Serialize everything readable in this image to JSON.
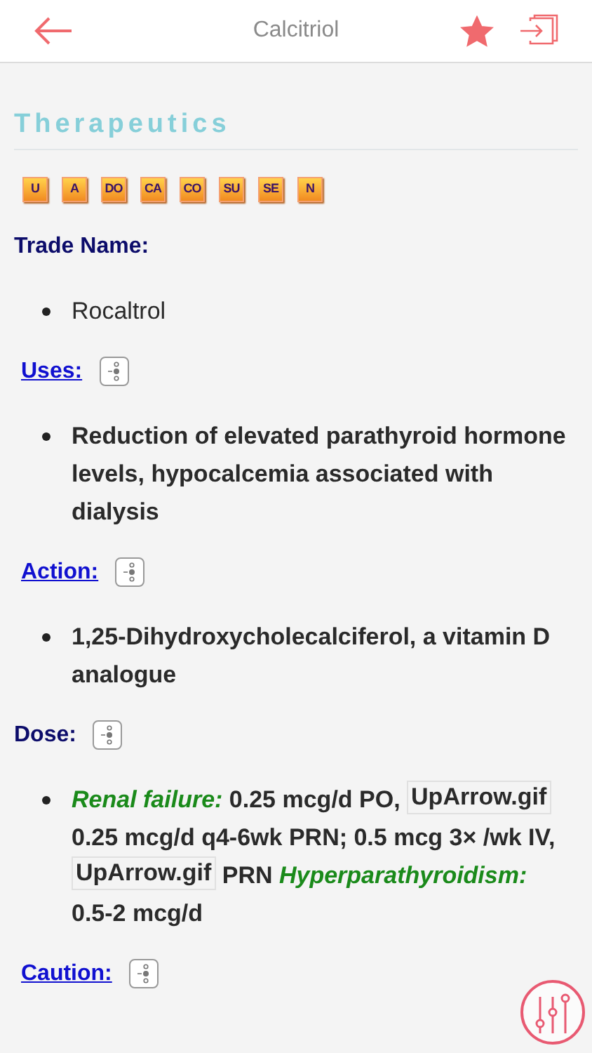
{
  "header": {
    "title": "Calcitriol",
    "favorite": true
  },
  "section_title": "Therapeutics",
  "badges": [
    "U",
    "A",
    "DO",
    "CA",
    "CO",
    "SU",
    "SE",
    "N"
  ],
  "sections": [
    {
      "heading": "Trade Name:",
      "link": false,
      "toggle": false,
      "items": [
        {
          "bold": false,
          "segments": [
            {
              "kind": "text",
              "text": "Rocaltrol"
            }
          ]
        }
      ]
    },
    {
      "heading": "Uses:",
      "link": true,
      "toggle": true,
      "items": [
        {
          "bold": true,
          "segments": [
            {
              "kind": "text",
              "text": "Reduction of elevated parathyroid hormone levels, hypocalcemia associated with dialysis"
            }
          ]
        }
      ]
    },
    {
      "heading": "Action:",
      "link": true,
      "toggle": true,
      "items": [
        {
          "bold": true,
          "segments": [
            {
              "kind": "text",
              "text": "1,25-Dihydroxycholecalciferol, a vitamin D analogue"
            }
          ]
        }
      ]
    },
    {
      "heading": "Dose:",
      "link": false,
      "toggle": true,
      "items": [
        {
          "bold": true,
          "segments": [
            {
              "kind": "label",
              "text": "Renal failure:"
            },
            {
              "kind": "text",
              "text": " 0.25 mcg/d PO, "
            },
            {
              "kind": "image_alt",
              "text": "UpArrow.gif"
            },
            {
              "kind": "text",
              "text": " 0.25 mcg/d q4-6wk PRN; 0.5 mcg 3× /wk IV, "
            },
            {
              "kind": "image_alt",
              "text": "UpArrow.gif"
            },
            {
              "kind": "text",
              "text": " PRN "
            },
            {
              "kind": "label",
              "text": "Hyperparathyroidism:"
            },
            {
              "kind": "text",
              "text": " 0.5-2 mcg/d"
            }
          ]
        }
      ]
    },
    {
      "heading": "Caution:",
      "link": true,
      "toggle": true
    }
  ]
}
